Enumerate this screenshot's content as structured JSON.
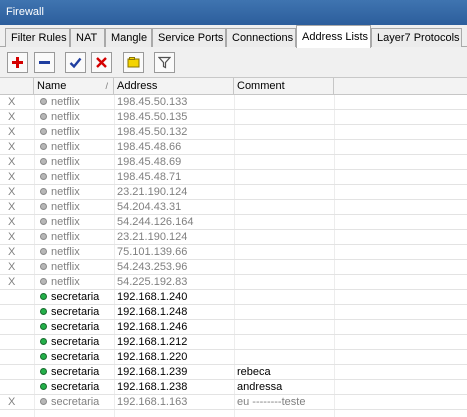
{
  "window": {
    "title": "Firewall"
  },
  "tabs": [
    {
      "label": "Filter Rules",
      "active": false
    },
    {
      "label": "NAT",
      "active": false
    },
    {
      "label": "Mangle",
      "active": false
    },
    {
      "label": "Service Ports",
      "active": false
    },
    {
      "label": "Connections",
      "active": false
    },
    {
      "label": "Address Lists",
      "active": true
    },
    {
      "label": "Layer7 Protocols",
      "active": false
    }
  ],
  "toolbar": {
    "buttons": [
      {
        "icon": "plus-icon",
        "color": "#d40000"
      },
      {
        "icon": "minus-icon",
        "color": "#1f3ea0"
      },
      {
        "icon": "check-icon",
        "color": "#1f3ea0"
      },
      {
        "icon": "x-icon",
        "color": "#d40000"
      },
      {
        "icon": "comment-icon",
        "color": "#e8c400"
      },
      {
        "icon": "filter-icon",
        "color": "#606060"
      }
    ]
  },
  "table": {
    "columns": {
      "name": "Name",
      "address": "Address",
      "comment": "Comment"
    },
    "rows": [
      {
        "flag": "X",
        "name": "netflix",
        "address": "198.45.50.133",
        "comment": "",
        "enabled": false
      },
      {
        "flag": "X",
        "name": "netflix",
        "address": "198.45.50.135",
        "comment": "",
        "enabled": false
      },
      {
        "flag": "X",
        "name": "netflix",
        "address": "198.45.50.132",
        "comment": "",
        "enabled": false
      },
      {
        "flag": "X",
        "name": "netflix",
        "address": "198.45.48.66",
        "comment": "",
        "enabled": false
      },
      {
        "flag": "X",
        "name": "netflix",
        "address": "198.45.48.69",
        "comment": "",
        "enabled": false
      },
      {
        "flag": "X",
        "name": "netflix",
        "address": "198.45.48.71",
        "comment": "",
        "enabled": false
      },
      {
        "flag": "X",
        "name": "netflix",
        "address": "23.21.190.124",
        "comment": "",
        "enabled": false
      },
      {
        "flag": "X",
        "name": "netflix",
        "address": "54.204.43.31",
        "comment": "",
        "enabled": false
      },
      {
        "flag": "X",
        "name": "netflix",
        "address": "54.244.126.164",
        "comment": "",
        "enabled": false
      },
      {
        "flag": "X",
        "name": "netflix",
        "address": "23.21.190.124",
        "comment": "",
        "enabled": false
      },
      {
        "flag": "X",
        "name": "netflix",
        "address": "75.101.139.66",
        "comment": "",
        "enabled": false
      },
      {
        "flag": "X",
        "name": "netflix",
        "address": "54.243.253.96",
        "comment": "",
        "enabled": false
      },
      {
        "flag": "X",
        "name": "netflix",
        "address": "54.225.192.83",
        "comment": "",
        "enabled": false
      },
      {
        "flag": "",
        "name": "secretaria",
        "address": "192.168.1.240",
        "comment": "",
        "enabled": true
      },
      {
        "flag": "",
        "name": "secretaria",
        "address": "192.168.1.248",
        "comment": "",
        "enabled": true
      },
      {
        "flag": "",
        "name": "secretaria",
        "address": "192.168.1.246",
        "comment": "",
        "enabled": true
      },
      {
        "flag": "",
        "name": "secretaria",
        "address": "192.168.1.212",
        "comment": "",
        "enabled": true
      },
      {
        "flag": "",
        "name": "secretaria",
        "address": "192.168.1.220",
        "comment": "",
        "enabled": true
      },
      {
        "flag": "",
        "name": "secretaria",
        "address": "192.168.1.239",
        "comment": "rebeca",
        "enabled": true
      },
      {
        "flag": "",
        "name": "secretaria",
        "address": "192.168.1.238",
        "comment": "andressa",
        "enabled": true
      },
      {
        "flag": "X",
        "name": "secretaria",
        "address": "192.168.1.163",
        "comment": "eu --------teste",
        "enabled": false
      }
    ]
  }
}
